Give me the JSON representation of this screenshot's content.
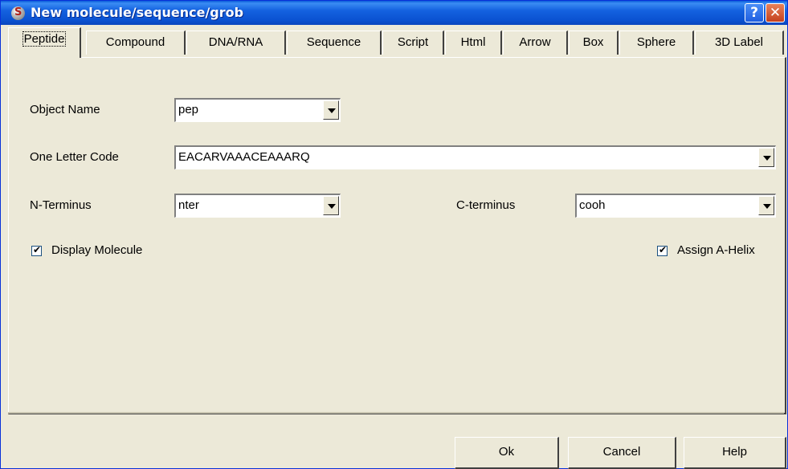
{
  "window": {
    "title": "New molecule/sequence/grob"
  },
  "tabs": [
    {
      "label": "Peptide"
    },
    {
      "label": "Compound"
    },
    {
      "label": "DNA/RNA"
    },
    {
      "label": "Sequence"
    },
    {
      "label": "Script"
    },
    {
      "label": "Html"
    },
    {
      "label": "Arrow"
    },
    {
      "label": "Box"
    },
    {
      "label": "Sphere"
    },
    {
      "label": "3D Label"
    }
  ],
  "form": {
    "object_name": {
      "label": "Object Name",
      "value": "pep"
    },
    "one_letter_code": {
      "label": "One Letter Code",
      "value": "EACARVAAACEAAARQ"
    },
    "n_terminus": {
      "label": "N-Terminus",
      "value": "nter"
    },
    "c_terminus": {
      "label": "C-terminus",
      "value": "cooh"
    },
    "display_molecule": {
      "label": "Display Molecule",
      "checked": true
    },
    "assign_a_helix": {
      "label": "Assign A-Helix",
      "checked": true
    }
  },
  "buttons": {
    "ok": "Ok",
    "cancel": "Cancel",
    "help": "Help"
  },
  "icons": {
    "help": "help-icon",
    "close": "close-icon",
    "app": "app-icon"
  },
  "colors": {
    "titlebar": "#0b52d1",
    "face": "#ece9d8"
  }
}
